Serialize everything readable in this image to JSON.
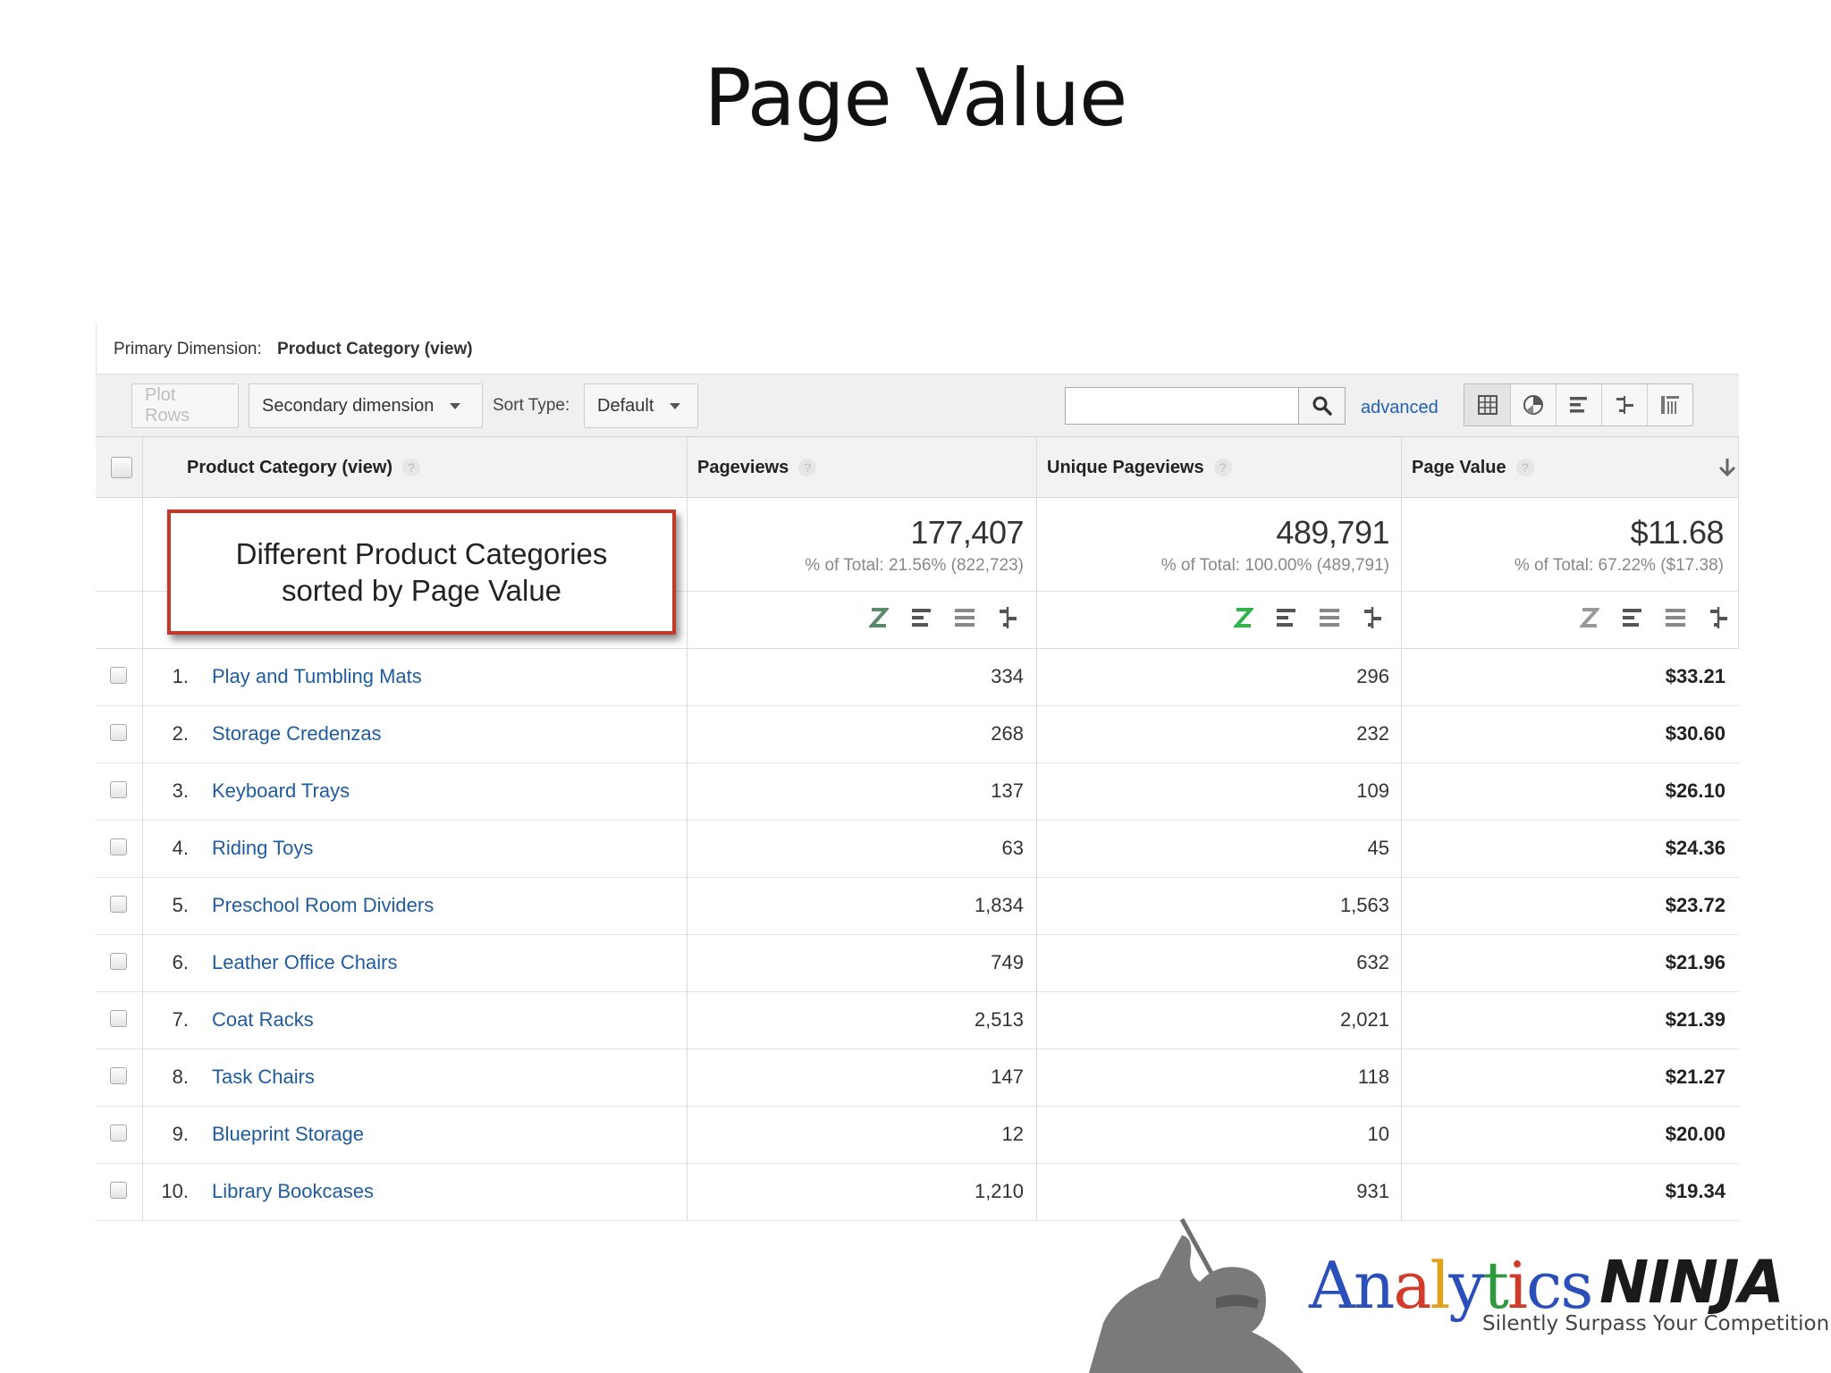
{
  "slide_title": "Page Value",
  "primary_dimension": {
    "label": "Primary Dimension:",
    "value": "Product Category (view)"
  },
  "toolbar": {
    "plot_rows": "Plot Rows",
    "secondary_dimension": "Secondary dimension",
    "sort_type_label": "Sort Type:",
    "sort_type_value": "Default",
    "search_value": "",
    "advanced": "advanced",
    "view_icons": [
      "table-view-icon",
      "pie-view-icon",
      "performance-view-icon",
      "comparison-view-icon",
      "pivot-view-icon"
    ]
  },
  "columns": {
    "dimension": "Product Category (view)",
    "pageviews": "Pageviews",
    "unique_pageviews": "Unique Pageviews",
    "page_value": "Page Value",
    "help_glyph": "?"
  },
  "totals": {
    "pageviews": {
      "value": "177,407",
      "sub": "% of Total: 21.56% (822,723)"
    },
    "unique_pageviews": {
      "value": "489,791",
      "sub": "% of Total: 100.00% (489,791)"
    },
    "page_value": {
      "value": "$11.68",
      "sub": "% of Total: 67.22% ($17.38)"
    }
  },
  "rows": [
    {
      "num": "1.",
      "category": "Play and Tumbling Mats",
      "pageviews": "334",
      "unique": "296",
      "value": "$33.21"
    },
    {
      "num": "2.",
      "category": "Storage Credenzas",
      "pageviews": "268",
      "unique": "232",
      "value": "$30.60"
    },
    {
      "num": "3.",
      "category": "Keyboard Trays",
      "pageviews": "137",
      "unique": "109",
      "value": "$26.10"
    },
    {
      "num": "4.",
      "category": "Riding Toys",
      "pageviews": "63",
      "unique": "45",
      "value": "$24.36"
    },
    {
      "num": "5.",
      "category": "Preschool Room Dividers",
      "pageviews": "1,834",
      "unique": "1,563",
      "value": "$23.72"
    },
    {
      "num": "6.",
      "category": "Leather Office Chairs",
      "pageviews": "749",
      "unique": "632",
      "value": "$21.96"
    },
    {
      "num": "7.",
      "category": "Coat Racks",
      "pageviews": "2,513",
      "unique": "2,021",
      "value": "$21.39"
    },
    {
      "num": "8.",
      "category": "Task Chairs",
      "pageviews": "147",
      "unique": "118",
      "value": "$21.27"
    },
    {
      "num": "9.",
      "category": "Blueprint Storage",
      "pageviews": "12",
      "unique": "10",
      "value": "$20.00"
    },
    {
      "num": "10.",
      "category": "Library Bookcases",
      "pageviews": "1,210",
      "unique": "931",
      "value": "$19.34"
    }
  ],
  "callout": {
    "line1": "Different Product Categories",
    "line2": "sorted by Page Value"
  },
  "logo": {
    "analytics": "Analytics",
    "ninja": "NINJA",
    "tagline": "Silently Surpass Your Competition"
  },
  "colors": {
    "link": "#1f5b9e",
    "callout_border": "#c0392b",
    "compare_active": "#2fb34a"
  }
}
